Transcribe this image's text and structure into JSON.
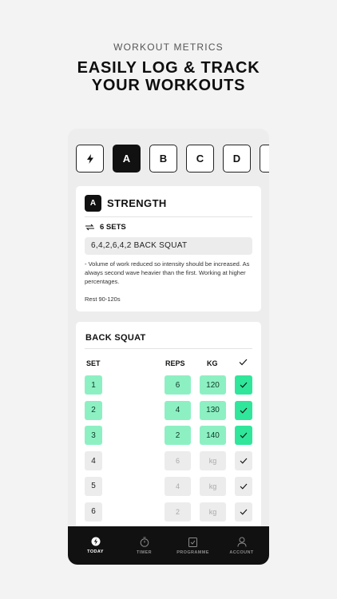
{
  "hero": {
    "eyebrow": "WORKOUT METRICS",
    "headline_line1": "EASILY LOG & TRACK",
    "headline_line2": "YOUR WORKOUTS"
  },
  "tabs": [
    {
      "label": "",
      "icon": "bolt-icon"
    },
    {
      "label": "A",
      "active": true
    },
    {
      "label": "B"
    },
    {
      "label": "C"
    },
    {
      "label": "D"
    }
  ],
  "block": {
    "badge": "A",
    "title": "STRENGTH",
    "sets_label": "6 SETS",
    "scheme": "6,4,2,6,4,2 BACK SQUAT",
    "notes": "- Volume of work reduced so intensity should be increased. As always second wave heavier than the first. Working at higher percentages.",
    "rest": "Rest 90-120s"
  },
  "exercise": {
    "title": "BACK SQUAT",
    "headers": {
      "set": "SET",
      "reps": "REPS",
      "kg": "KG"
    },
    "rows": [
      {
        "set": "1",
        "reps": "6",
        "kg": "120",
        "done": true
      },
      {
        "set": "2",
        "reps": "4",
        "kg": "130",
        "done": true
      },
      {
        "set": "3",
        "reps": "2",
        "kg": "140",
        "done": true
      },
      {
        "set": "4",
        "reps": "6",
        "kg": "kg",
        "done": false
      },
      {
        "set": "5",
        "reps": "4",
        "kg": "kg",
        "done": false
      },
      {
        "set": "6",
        "reps": "2",
        "kg": "kg",
        "done": false
      }
    ]
  },
  "nav": {
    "today": "TODAY",
    "timer": "TIMER",
    "programme": "PROGRAMME",
    "account": "ACCOUNT"
  },
  "colors": {
    "accent_light": "#8df0c3",
    "accent": "#2fe69a",
    "dark": "#111111"
  }
}
